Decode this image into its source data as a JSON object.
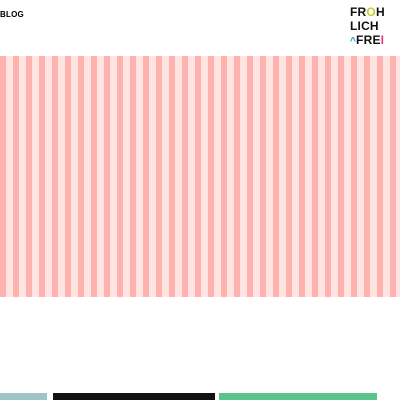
{
  "header": {
    "nav_label": "BLOG"
  },
  "logo": {
    "line1": {
      "a": "FR",
      "o": "O",
      "b": "H"
    },
    "line2": "LICH",
    "line3": {
      "caret": "^",
      "text": "FRE",
      "bar": "I"
    }
  },
  "hero": {
    "pattern": "vertical-stripes",
    "colors": [
      "#ffb3b1",
      "#ffe4e2"
    ]
  },
  "footer_bars": {
    "colors": [
      "#9fc4c8",
      "#111111",
      "#5cc38a"
    ]
  }
}
